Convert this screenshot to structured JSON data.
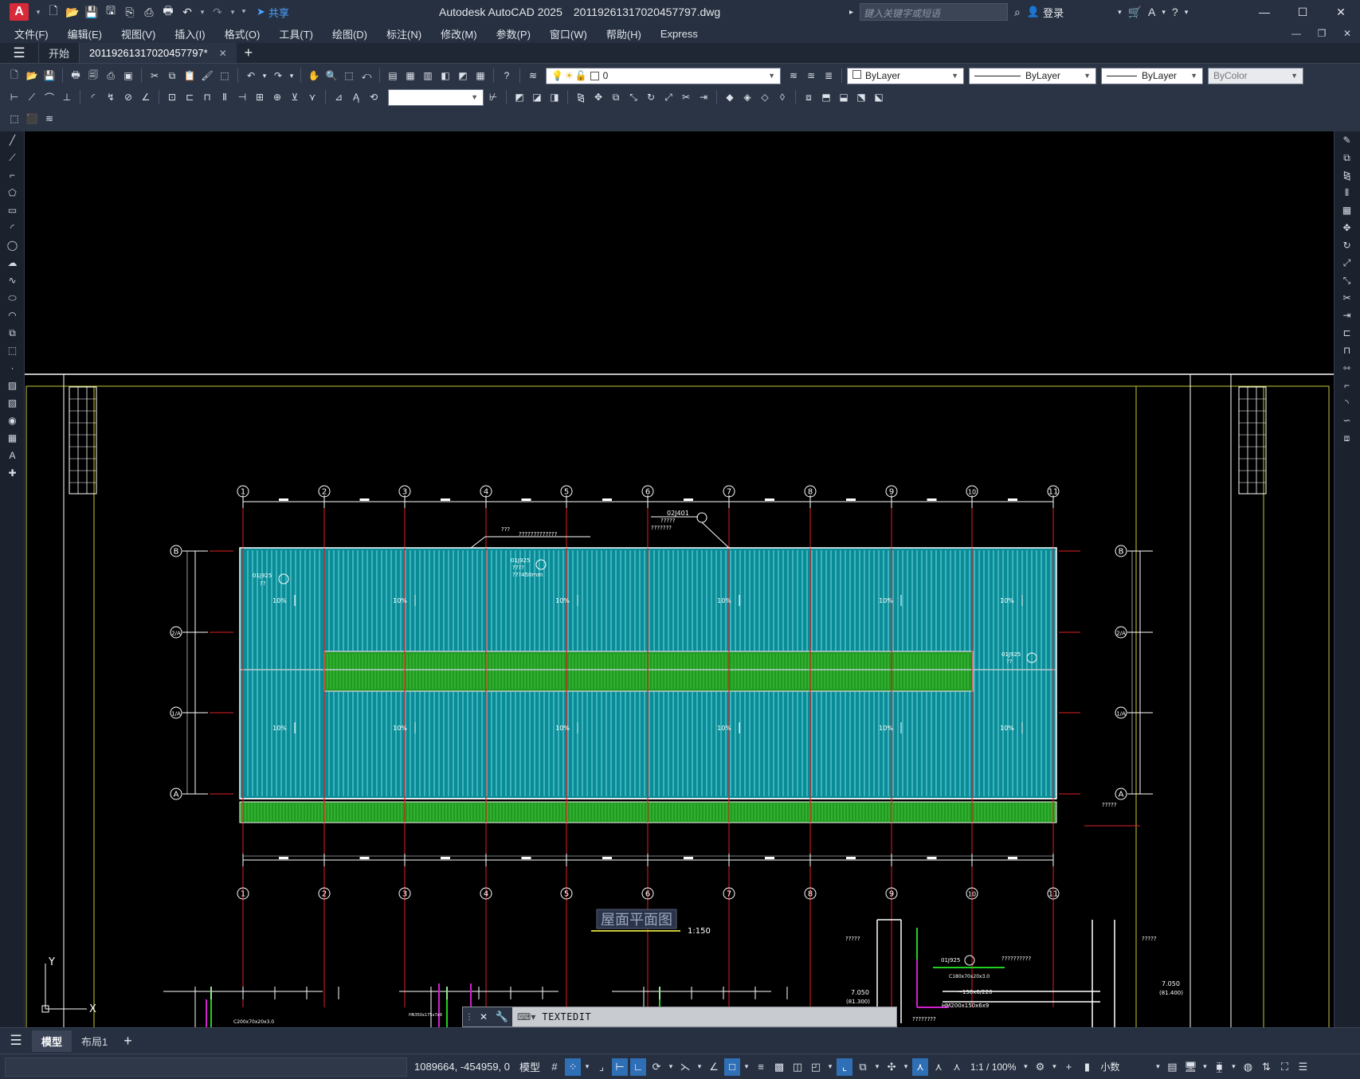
{
  "app": {
    "logo": "A",
    "title": "Autodesk AutoCAD 2025",
    "filename": "20119261317020457797.dwg",
    "share_label": "共享",
    "search_placeholder": "键入关键字或短语",
    "login_label": "登录"
  },
  "menu": [
    "文件(F)",
    "编辑(E)",
    "视图(V)",
    "插入(I)",
    "格式(O)",
    "工具(T)",
    "绘图(D)",
    "标注(N)",
    "修改(M)",
    "参数(P)",
    "窗口(W)",
    "帮助(H)",
    "Express"
  ],
  "tabs": {
    "start": "开始",
    "document": "20119261317020457797*"
  },
  "properties": {
    "layer": "0",
    "color": "ByLayer",
    "linetype": "ByLayer",
    "lineweight": "ByLayer",
    "plotstyle": "ByColor"
  },
  "drawing": {
    "grid_columns": [
      "1",
      "2",
      "3",
      "4",
      "5",
      "6",
      "7",
      "8",
      "9",
      "10",
      "11"
    ],
    "grid_rows": [
      "B",
      "2/A",
      "1/A",
      "A"
    ],
    "slope_labels": [
      "10%",
      "10%",
      "10%",
      "10%",
      "10%",
      "10%",
      "10%",
      "10%",
      "10%",
      "10%",
      "10%",
      "10%"
    ],
    "annotations": {
      "top_ref": "02J401",
      "top_ref_sub": "?????",
      "top_ref_sub2": "???????",
      "top_note": "???",
      "top_note2": "?????????????",
      "ref_left": "01J925",
      "ref_left_sub": "??",
      "ref_mid": "01J925",
      "ref_mid_sub": "????",
      "ref_mid_sub2": "???450mm",
      "ref_right": "01J925",
      "ref_right_sub": "??",
      "right_note": "?????",
      "detail_note1": "?????",
      "detail_note2": "?????",
      "detail_ref": "01J925",
      "detail_long_note": "??????????",
      "detail_c": "C180x70x20x3.0",
      "detail_elev_left": "7.050",
      "detail_elev_left2": "(81.300)",
      "detail_elev_right": "7.050",
      "detail_elev_right2": "(81.400)",
      "detail_150": "~150x6/220",
      "detail_hm": "HM200x150x6x9",
      "detail_bottom": "????????",
      "detail_c2": "C200x70x20x3.0",
      "detail_hn": "HN350x175x7x9"
    },
    "plan_title": "屋面平面图",
    "plan_scale": "1:150",
    "ucs_x": "X",
    "ucs_y": "Y"
  },
  "textedit_label": "TEXTEDIT",
  "layout_tabs": [
    "模型",
    "布局1"
  ],
  "status": {
    "coords": "1089664, -454959, 0",
    "model_label": "模型",
    "scale": "1:1 / 100%",
    "units": "小数"
  },
  "colors": {
    "roof_fill": "#0a8c96",
    "roof_lines": "#7fe6ef",
    "gutter_green": "#1f9b1f",
    "axis_red": "#e02020",
    "sheet_border": "#c8c838",
    "white": "#ffffff"
  }
}
